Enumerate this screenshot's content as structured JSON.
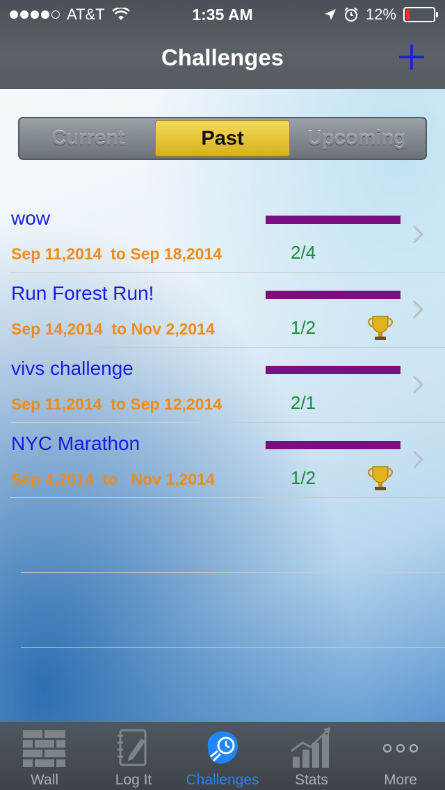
{
  "status_bar": {
    "carrier": "AT&T",
    "time": "1:35 AM",
    "battery_percent": "12%",
    "battery_level": 0.12
  },
  "nav": {
    "title": "Challenges",
    "add_icon": "plus-icon"
  },
  "segments": {
    "items": [
      "Current",
      "Past",
      "Upcoming"
    ],
    "selected": "Past"
  },
  "challenges": [
    {
      "name": "wow",
      "date_from": "Sep 11,2014",
      "date_to": "Sep 18,2014",
      "count": "2/4",
      "trophy": false
    },
    {
      "name": "Run Forest Run!",
      "date_from": "Sep 14,2014",
      "date_to": "Nov 2,2014",
      "count": "1/2",
      "trophy": true
    },
    {
      "name": "vivs challenge",
      "date_from": "Sep 11,2014",
      "date_to": "Sep 12,2014",
      "count": "2/1",
      "trophy": false
    },
    {
      "name": "NYC Marathon",
      "date_from": "Sep 4,2014",
      "date_to": "Nov 1,2014",
      "count": "1/2",
      "trophy": true
    }
  ],
  "date_connector": "to",
  "tabbar": {
    "items": [
      {
        "label": "Wall",
        "icon": "brick-wall-icon"
      },
      {
        "label": "Log It",
        "icon": "notebook-pencil-icon"
      },
      {
        "label": "Challenges",
        "icon": "challenge-icon"
      },
      {
        "label": "Stats",
        "icon": "bar-chart-icon"
      },
      {
        "label": "More",
        "icon": "more-dots-icon"
      }
    ],
    "active": "Challenges"
  },
  "colors": {
    "accent": "#1f86ff",
    "segment_active": "#e8c83a",
    "challenge_name": "#1a1ae6",
    "dates": "#f28a17",
    "count": "#1e8a3d",
    "progress_bar": "#7a0f7f"
  }
}
